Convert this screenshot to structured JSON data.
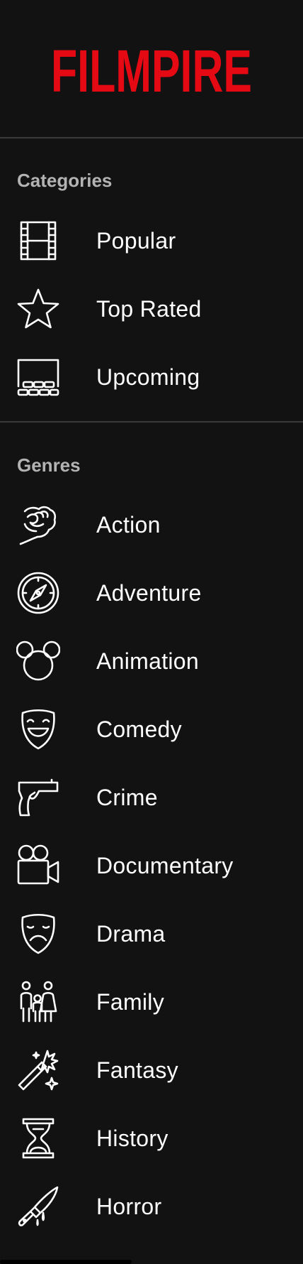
{
  "app": {
    "logo_text": "FILMPIRE",
    "brand_color": "#e50914"
  },
  "categories": {
    "title": "Categories",
    "items": [
      {
        "label": "Popular",
        "icon": "film-strip-icon"
      },
      {
        "label": "Top Rated",
        "icon": "star-icon"
      },
      {
        "label": "Upcoming",
        "icon": "theater-screen-icon"
      }
    ]
  },
  "genres": {
    "title": "Genres",
    "items": [
      {
        "label": "Action",
        "icon": "fist-icon"
      },
      {
        "label": "Adventure",
        "icon": "compass-icon"
      },
      {
        "label": "Animation",
        "icon": "mouse-ears-icon"
      },
      {
        "label": "Comedy",
        "icon": "comedy-mask-icon"
      },
      {
        "label": "Crime",
        "icon": "pistol-icon"
      },
      {
        "label": "Documentary",
        "icon": "movie-camera-icon"
      },
      {
        "label": "Drama",
        "icon": "drama-mask-icon"
      },
      {
        "label": "Family",
        "icon": "family-icon"
      },
      {
        "label": "Fantasy",
        "icon": "magic-wand-icon"
      },
      {
        "label": "History",
        "icon": "hourglass-icon"
      },
      {
        "label": "Horror",
        "icon": "knife-icon"
      }
    ]
  },
  "colors": {
    "background": "#121212",
    "section_title": "#b3b3b3",
    "text": "#ffffff",
    "divider": "#3a3a3a"
  }
}
